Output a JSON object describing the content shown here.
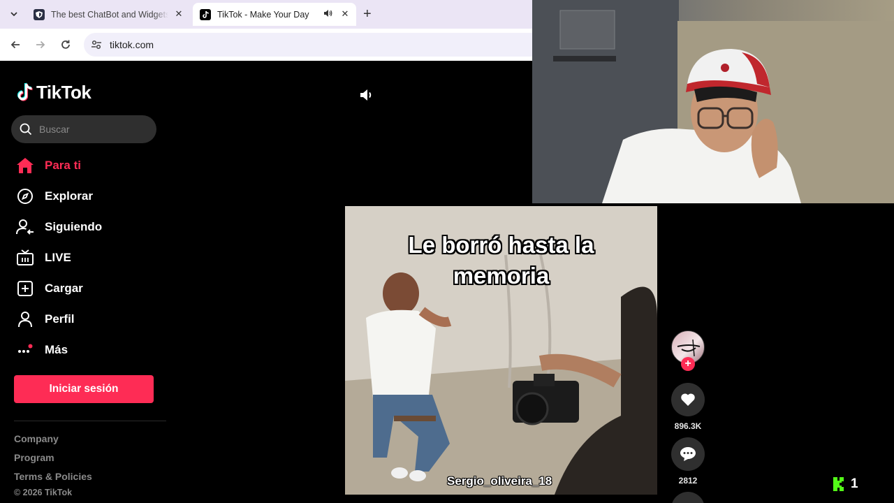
{
  "browser": {
    "tabs": [
      {
        "title": "The best ChatBot and Widgets",
        "icon": "shield-logo-icon",
        "active": false
      },
      {
        "title": "TikTok - Make Your Day",
        "icon": "tiktok-favicon-icon",
        "active": true,
        "audio_playing": true
      }
    ],
    "address": "tiktok.com"
  },
  "sidebar": {
    "logo_text": "TikTok",
    "search_placeholder": "Buscar",
    "nav": [
      {
        "label": "Para ti",
        "icon": "home-icon",
        "active": true
      },
      {
        "label": "Explorar",
        "icon": "compass-icon",
        "active": false
      },
      {
        "label": "Siguiendo",
        "icon": "following-user-icon",
        "active": false
      },
      {
        "label": "LIVE",
        "icon": "live-tv-icon",
        "active": false
      },
      {
        "label": "Cargar",
        "icon": "upload-plus-icon",
        "active": false
      },
      {
        "label": "Perfil",
        "icon": "profile-user-icon",
        "active": false
      },
      {
        "label": "Más",
        "icon": "more-dots-icon",
        "active": false
      }
    ],
    "login_label": "Iniciar sesión",
    "footer_links": [
      "Company",
      "Program",
      "Terms & Policies"
    ],
    "copyright": "© 2026 TikTok"
  },
  "video": {
    "caption": "Le borró hasta la memoria",
    "handle": "Sergio_oliveira_18"
  },
  "actions": {
    "likes": "896.3K",
    "comments": "2812"
  },
  "overlay": {
    "kick_count": "1"
  },
  "colors": {
    "accent": "#fe2c55",
    "sidebar_bg": "#000000",
    "tabstrip_bg": "#ebe5f5",
    "kick_green": "#53fc18"
  }
}
